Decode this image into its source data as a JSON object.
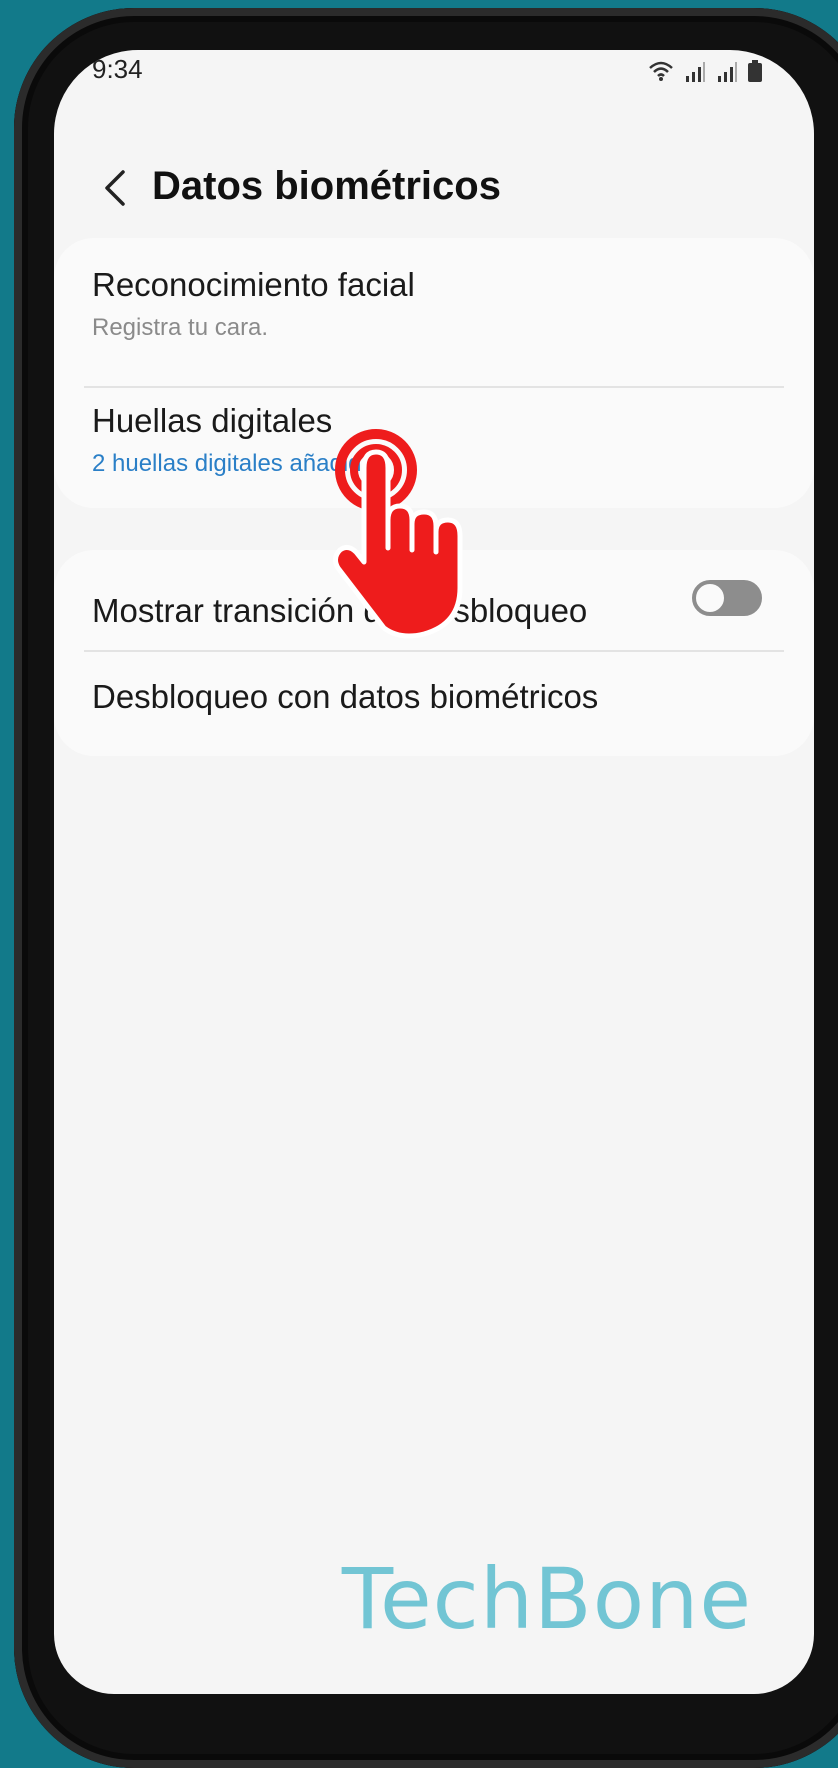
{
  "status_bar": {
    "time": "9:34",
    "icons": [
      "wifi-icon",
      "signal-icon",
      "signal-icon",
      "battery-icon"
    ]
  },
  "header": {
    "back_icon": "chevron-left-icon",
    "title": "Datos biométricos"
  },
  "section_1": {
    "items": [
      {
        "title": "Reconocimiento facial",
        "subtitle": "Registra tu cara."
      },
      {
        "title": "Huellas digitales",
        "subtitle": "2 huellas digitales añadidas"
      }
    ]
  },
  "section_2": {
    "items": [
      {
        "title": "Mostrar transición del desbloqueo",
        "toggle_on": false
      },
      {
        "title": "Desbloqueo con datos biométricos"
      }
    ]
  },
  "overlay": {
    "tap_icon": "tap-hand-icon",
    "watermark": "TechBone"
  },
  "colors": {
    "background": "#127a8a",
    "screen": "#f5f5f5",
    "link_blue": "#2a7fc7",
    "tap_red": "#ee1c1c",
    "watermark": "#6bc3d3"
  }
}
